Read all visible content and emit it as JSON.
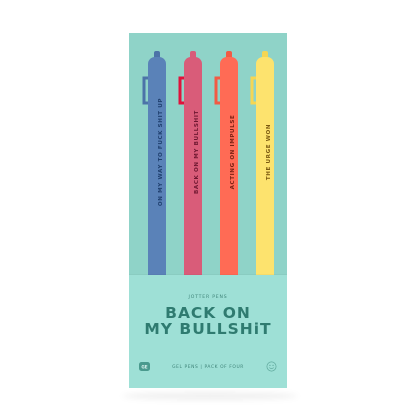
{
  "product": {
    "sleeve_subtitle": "JOTTER PENS",
    "title_line_1": "BACK ON",
    "title_line_2": "MY BULLSHiT",
    "footer": "GEL PENS | PACK OF FOUR",
    "badge_text": "GE",
    "colors": {
      "backboard": "#8fd3c8",
      "sleeve": "#9ee0d6",
      "sleeve_text": "#2f7b70"
    }
  },
  "pens": [
    {
      "text": "ON MY WAY TO FUCK SHIT UP",
      "color": "#5a82b8",
      "clip": "#4c73a8",
      "text_color": "#1f3f6e"
    },
    {
      "text": "BACK ON MY BULLSHIT",
      "color": "#d95c79",
      "clip": "#e0123b",
      "text_color": "#6e1730"
    },
    {
      "text": "ACTING ON IMPULSE",
      "color": "#ff6b55",
      "clip": "#f25a44",
      "text_color": "#7a1f12"
    },
    {
      "text": "THE URGE WON",
      "color": "#fde36e",
      "clip": "#f5d653",
      "text_color": "#7b5a10"
    }
  ]
}
